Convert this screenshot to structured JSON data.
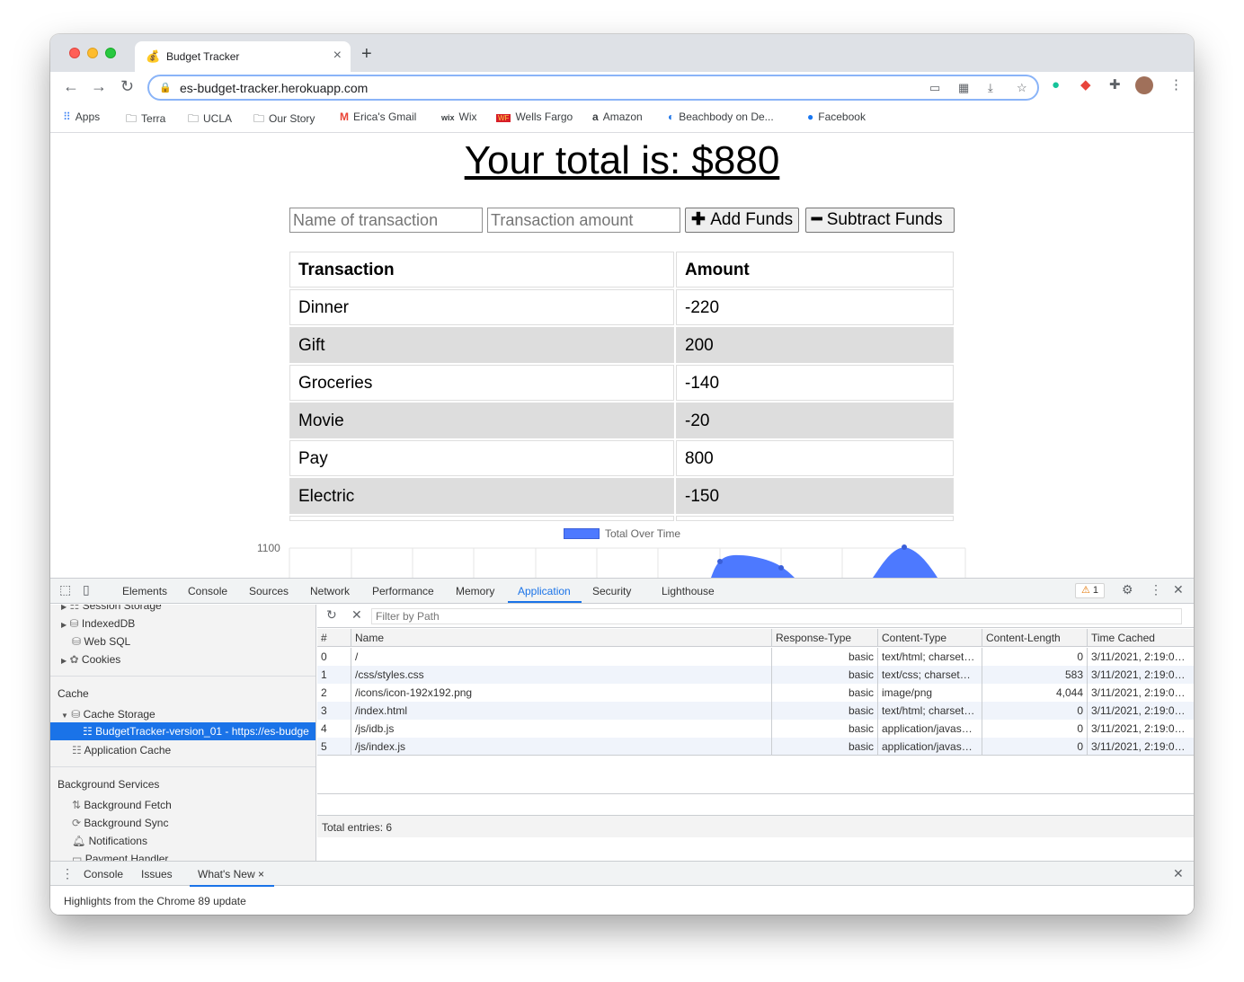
{
  "browser": {
    "tab_title": "Budget Tracker",
    "tab_favicon": "money-bag-icon",
    "url": "es-budget-tracker.herokuapp.com"
  },
  "bookmarks": [
    {
      "label": "Apps",
      "icon": "apps-grid-icon"
    },
    {
      "label": "Terra",
      "icon": "folder-icon"
    },
    {
      "label": "UCLA",
      "icon": "folder-icon"
    },
    {
      "label": "Our Story",
      "icon": "folder-icon"
    },
    {
      "label": "Erica's Gmail",
      "icon": "gmail-icon"
    },
    {
      "label": "Wix",
      "icon": "wix-icon"
    },
    {
      "label": "Wells Fargo",
      "icon": "wells-fargo-icon"
    },
    {
      "label": "Amazon",
      "icon": "amazon-icon"
    },
    {
      "label": "Beachbody on De...",
      "icon": "beachbody-icon"
    },
    {
      "label": "Facebook",
      "icon": "facebook-icon"
    }
  ],
  "page": {
    "total_heading": "Your total is: $880",
    "name_placeholder": "Name of transaction",
    "amount_placeholder": "Transaction amount",
    "add_button": "Add Funds",
    "subtract_button": "Subtract Funds",
    "table_headers": [
      "Transaction",
      "Amount"
    ],
    "transactions": [
      {
        "name": "Dinner",
        "amount": "-220"
      },
      {
        "name": "Gift",
        "amount": "200"
      },
      {
        "name": "Groceries",
        "amount": "-140"
      },
      {
        "name": "Movie",
        "amount": "-20"
      },
      {
        "name": "Pay",
        "amount": "800"
      },
      {
        "name": "Electric",
        "amount": "-150"
      }
    ]
  },
  "chart_data": {
    "type": "area",
    "series": [
      {
        "name": "Total Over Time",
        "color": "#4d79ff"
      }
    ],
    "y_tick_visible": "1100",
    "note_visible": "chart partially visible; only top tick label shown"
  },
  "devtools": {
    "tabs": [
      "Elements",
      "Console",
      "Sources",
      "Network",
      "Performance",
      "Memory",
      "Application",
      "Security",
      "Lighthouse"
    ],
    "active_tab": "Application",
    "warning_count": "1",
    "sidebar": {
      "storage_items": [
        "Session Storage",
        "IndexedDB",
        "Web SQL",
        "Cookies"
      ],
      "cache_section": "Cache",
      "cache_storage": "Cache Storage",
      "cache_entry": "BudgetTracker-version_01 - https://es-budge",
      "application_cache": "Application Cache",
      "bg_section": "Background Services",
      "bg_items": [
        "Background Fetch",
        "Background Sync",
        "Notifications",
        "Payment Handler"
      ]
    },
    "filter_placeholder": "Filter by Path",
    "grid_headers": [
      "#",
      "Name",
      "Response-Type",
      "Content-Type",
      "Content-Length",
      "Time Cached"
    ],
    "grid_rows": [
      [
        "0",
        "/",
        "basic",
        "text/html; charset…",
        "0",
        "3/11/2021, 2:19:0…"
      ],
      [
        "1",
        "/css/styles.css",
        "basic",
        "text/css; charset…",
        "583",
        "3/11/2021, 2:19:0…"
      ],
      [
        "2",
        "/icons/icon-192x192.png",
        "basic",
        "image/png",
        "4,044",
        "3/11/2021, 2:19:0…"
      ],
      [
        "3",
        "/index.html",
        "basic",
        "text/html; charset…",
        "0",
        "3/11/2021, 2:19:0…"
      ],
      [
        "4",
        "/js/idb.js",
        "basic",
        "application/javas…",
        "0",
        "3/11/2021, 2:19:0…"
      ],
      [
        "5",
        "/js/index.js",
        "basic",
        "application/javas…",
        "0",
        "3/11/2021, 2:19:0…"
      ]
    ],
    "total_entries": "Total entries: 6",
    "drawer_tabs": [
      "Console",
      "Issues",
      "What's New"
    ],
    "drawer_active": "What's New",
    "drawer_content": "Highlights from the Chrome 89 update"
  },
  "colors": {
    "accent": "#1a73e8",
    "chart_fill": "#4d79ff",
    "row_alt": "#dddddd"
  }
}
